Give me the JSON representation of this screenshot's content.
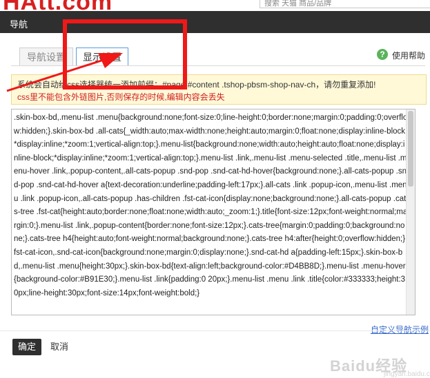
{
  "background_page": {
    "brand_text": "HAtt.com",
    "search_placeholder": "搜索 天猫 商品/品牌"
  },
  "dialog": {
    "title": "导航"
  },
  "tabs": [
    {
      "label": "导航设置"
    },
    {
      "label": "显示设置"
    }
  ],
  "help": {
    "icon_glyph": "?",
    "label": "使用帮助"
  },
  "notice": {
    "line1": "系统会自动给css选择器统一添加前缀：#page #content .tshop-pbsm-shop-nav-ch，请勿重复添加!",
    "line2": "css里不能包含外链图片,否则保存的时候,编辑内容会丢失"
  },
  "css_editor": {
    "value": ".skin-box-bd,.menu-list .menu{background:none;font-size:0;line-height:0;border:none;margin:0;padding:0;overflow:hidden;}.skin-box-bd .all-cats{_width:auto;max-width:none;height:auto;margin:0;float:none;display:inline-block;*display:inline;*zoom:1;vertical-align:top;}.menu-list{background:none;width:auto;height:auto;float:none;display:inline-block;*display:inline;*zoom:1;vertical-align:top;}.menu-list .link,.menu-list .menu-selected .title,.menu-list .menu-hover .link,.popup-content,.all-cats-popup .snd-pop .snd-cat-hd-hover{background:none;}.all-cats-popup .snd-pop .snd-cat-hd-hover a{text-decoration:underline;padding-left:17px;}.all-cats .link .popup-icon,.menu-list .menu .link .popup-icon,.all-cats-popup .has-children .fst-cat-icon{display:none;background:none;}.all-cats-popup .cats-tree .fst-cat{height:auto;border:none;float:none;width:auto;_zoom:1;}.title{font-size:12px;font-weight:normal;margin:0;}.menu-list .link,.popup-content{border:none;font-size:12px;}.cats-tree{margin:0;padding:0;background:none;}.cats-tree h4{height:auto;font-weight:normal;background:none;}.cats-tree h4:after{height:0;overflow:hidden;}.fst-cat-icon,.snd-cat-icon{background:none;margin:0;display:none;}.snd-cat-hd a{padding-left:15px;}.skin-box-bd,.menu-list .menu{height:30px;}.skin-box-bd{text-align:left;background-color:#D4BB8D;}.menu-list .menu-hover{background-color:#B91E30;}.menu-list .link{padding:0 20px;}.menu-list .menu .link .title{color:#333333;height:30px;line-height:30px;font-size:14px;font-weight:bold;}"
  },
  "custom_link": {
    "label": "自定义导航示例"
  },
  "buttons": {
    "ok": "确定",
    "cancel": "取消"
  },
  "watermark": {
    "text": "Baidu经验",
    "sub": "jingyan.baidu.com"
  },
  "colors": {
    "header_bg": "#2f2f2f",
    "annotation_red": "#f01818",
    "notice_bg": "#fff9d8",
    "warning_red": "#d02020",
    "help_green": "#5bb35b",
    "link_blue": "#3366cc"
  }
}
